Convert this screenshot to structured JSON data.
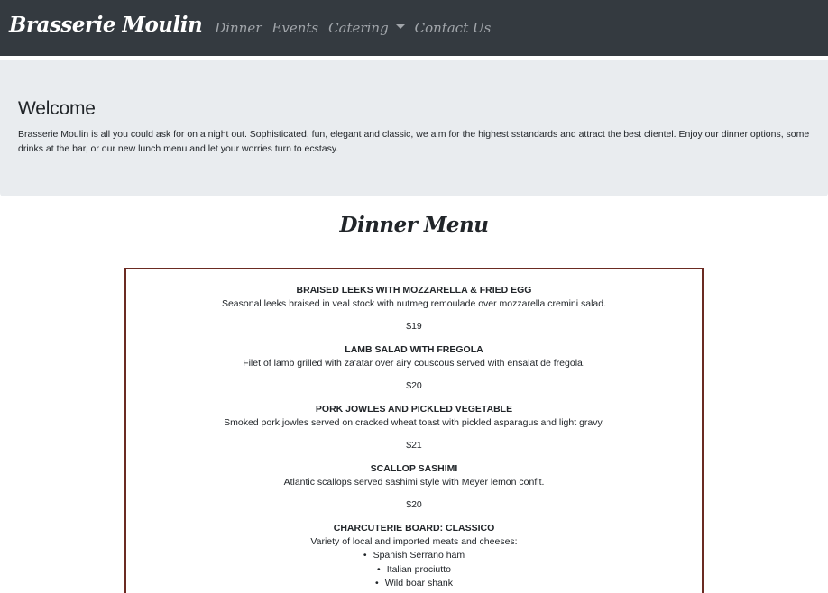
{
  "nav": {
    "brand": "Brasserie Moulin",
    "links": [
      {
        "label": "Dinner"
      },
      {
        "label": "Events"
      },
      {
        "label": "Catering",
        "dropdown": true
      },
      {
        "label": "Contact Us"
      }
    ]
  },
  "jumbotron": {
    "heading": "Welcome",
    "text": "Brasserie Moulin is all you could ask for on a night out. Sophisticated, fun, elegant and classic, we aim for the highest sstandards and attract the best clientel. Enjoy our dinner options, some drinks at the bar, or our new lunch menu and let your worries turn to ecstasy."
  },
  "menu": {
    "title": "Dinner Menu",
    "items": [
      {
        "name": "BRAISED LEEKS WITH MOZZARELLA & FRIED EGG",
        "description": "Seasonal leeks braised in veal stock with nutmeg remoulade over mozzarella cremini salad.",
        "price": "$19"
      },
      {
        "name": "LAMB SALAD WITH FREGOLA",
        "description": "Filet of lamb grilled with za'atar over airy couscous served with ensalat de fregola.",
        "price": "$20"
      },
      {
        "name": "PORK JOWLES AND PICKLED VEGETABLE",
        "description": "Smoked pork jowles served on cracked wheat toast with pickled asparagus and light gravy.",
        "price": "$21"
      },
      {
        "name": "SCALLOP SASHIMI",
        "description": "Atlantic scallops served sashimi style with Meyer lemon confit.",
        "price": "$20"
      },
      {
        "name": "CHARCUTERIE BOARD: CLASSICO",
        "description": "Variety of local and imported meats and cheeses:",
        "sub_items": [
          "Spanish Serrano ham",
          "Italian prociutto",
          "Wild boar shank"
        ]
      }
    ]
  },
  "colors": {
    "navbar_bg": "#343a40",
    "jumbotron_bg": "#e9ecef",
    "menu_border": "#6b2b22"
  }
}
